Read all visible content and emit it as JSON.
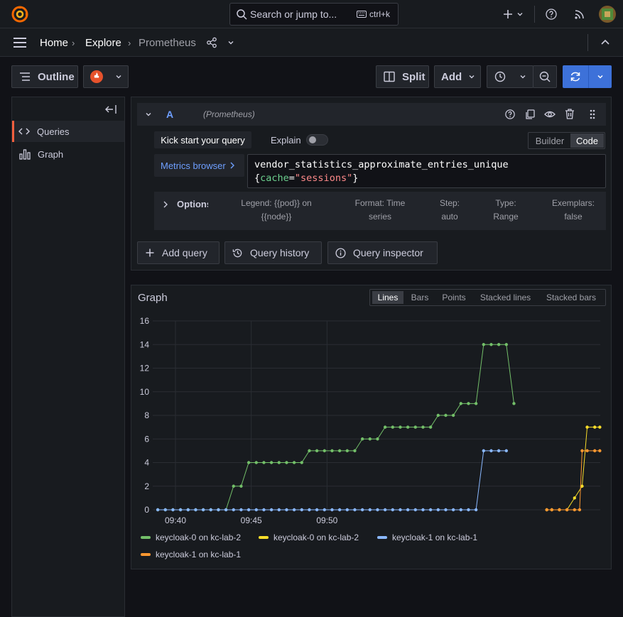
{
  "topbar": {
    "search_placeholder": "Search or jump to...",
    "search_shortcut": "ctrl+k",
    "plus_label": "+"
  },
  "breadcrumb": {
    "items": [
      "Home",
      "Explore",
      "Prometheus"
    ]
  },
  "toolbar": {
    "outline_label": "Outline",
    "split_label": "Split",
    "add_label": "Add"
  },
  "sidebar": {
    "items": [
      {
        "label": "Queries",
        "icon": "code-icon"
      },
      {
        "label": "Graph",
        "icon": "bar-chart-icon"
      }
    ]
  },
  "query": {
    "ref": "A",
    "datasource": "(Prometheus)",
    "kick_start": "Kick start your query",
    "explain": "Explain",
    "mode_builder": "Builder",
    "mode_code": "Code",
    "metrics_browser": "Metrics browser",
    "expr_metric": "vendor_statistics_approximate_entries_unique",
    "expr_brace_open": "{",
    "expr_label": "cache",
    "expr_eq": "=",
    "expr_value": "\"sessions\"",
    "expr_brace_close": "}",
    "options_label": "Options",
    "options": [
      {
        "l1": "Legend: {{pod}} on",
        "l2": "{{node}}"
      },
      {
        "l1": "Format: Time",
        "l2": "series"
      },
      {
        "l1": "Step:",
        "l2": "auto"
      },
      {
        "l1": "Type:",
        "l2": "Range"
      },
      {
        "l1": "Exemplars:",
        "l2": "false"
      }
    ],
    "add_query": "Add query",
    "query_history": "Query history",
    "query_inspector": "Query inspector"
  },
  "graph": {
    "title": "Graph",
    "modes": [
      "Lines",
      "Bars",
      "Points",
      "Stacked lines",
      "Stacked bars"
    ],
    "active_mode": "Lines"
  },
  "colors": {
    "accent_blue": "#3d71d9",
    "grafana_orange": "#f55f3e",
    "green": "#73bf69",
    "yellow": "#fade2a",
    "blue": "#8ab8ff",
    "orange": "#ff9830"
  },
  "chart_data": {
    "type": "line",
    "x_ticks": [
      "09:40",
      "09:45",
      "09:50"
    ],
    "y_ticks": [
      "0",
      "2",
      "4",
      "6",
      "8",
      "10",
      "12",
      "14",
      "16"
    ],
    "ylim": [
      0,
      16
    ],
    "grid": true,
    "legend_position": "bottom",
    "series": [
      {
        "name": "keycloak-0 on kc-lab-2",
        "color": "#73bf69",
        "points": [
          [
            "09:38:50",
            0
          ],
          [
            "09:39:20",
            0
          ],
          [
            "09:39:50",
            0
          ],
          [
            "09:40:20",
            0
          ],
          [
            "09:40:50",
            0
          ],
          [
            "09:41:20",
            0
          ],
          [
            "09:41:50",
            0
          ],
          [
            "09:42:20",
            0
          ],
          [
            "09:42:50",
            0
          ],
          [
            "09:43:20",
            0
          ],
          [
            "09:43:50",
            2
          ],
          [
            "09:44:20",
            2
          ],
          [
            "09:44:50",
            4
          ],
          [
            "09:45:20",
            4
          ],
          [
            "09:45:50",
            4
          ],
          [
            "09:46:20",
            4
          ],
          [
            "09:46:50",
            4
          ],
          [
            "09:47:20",
            4
          ],
          [
            "09:47:50",
            4
          ],
          [
            "09:48:20",
            4
          ],
          [
            "09:48:50",
            5
          ],
          [
            "09:49:20",
            5
          ],
          [
            "09:49:50",
            5
          ],
          [
            "09:50:20",
            5
          ],
          [
            "09:50:50",
            5
          ],
          [
            "09:51:20",
            5
          ],
          [
            "09:51:50",
            5
          ],
          [
            "09:52:20",
            6
          ],
          [
            "09:52:50",
            6
          ],
          [
            "09:53:20",
            6
          ],
          [
            "09:53:50",
            7
          ],
          [
            "09:54:20",
            7
          ],
          [
            "09:54:50",
            7
          ],
          [
            "09:55:20",
            7
          ],
          [
            "09:55:50",
            7
          ],
          [
            "09:56:20",
            7
          ],
          [
            "09:56:50",
            7
          ],
          [
            "09:57:20",
            8
          ],
          [
            "09:57:50",
            8
          ],
          [
            "09:58:20",
            8
          ],
          [
            "09:58:50",
            9
          ],
          [
            "09:59:20",
            9
          ],
          [
            "09:59:50",
            9
          ],
          [
            "10:00:20",
            14
          ],
          [
            "10:00:50",
            14
          ],
          [
            "10:01:20",
            14
          ],
          [
            "10:01:50",
            14
          ],
          [
            "10:02:20",
            9
          ]
        ]
      },
      {
        "name": "keycloak-0 on kc-lab-2",
        "color": "#fade2a",
        "points": [
          [
            "10:04:30",
            0
          ],
          [
            "10:04:50",
            0
          ],
          [
            "10:05:20",
            0
          ],
          [
            "10:05:50",
            0
          ],
          [
            "10:06:20",
            1
          ],
          [
            "10:06:50",
            2
          ],
          [
            "10:07:10",
            7
          ],
          [
            "10:07:40",
            7
          ],
          [
            "10:08:00",
            7
          ]
        ]
      },
      {
        "name": "keycloak-1 on kc-lab-1",
        "color": "#8ab8ff",
        "points": [
          [
            "09:38:50",
            0
          ],
          [
            "09:39:20",
            0
          ],
          [
            "09:39:50",
            0
          ],
          [
            "09:40:20",
            0
          ],
          [
            "09:40:50",
            0
          ],
          [
            "09:41:20",
            0
          ],
          [
            "09:41:50",
            0
          ],
          [
            "09:42:20",
            0
          ],
          [
            "09:42:50",
            0
          ],
          [
            "09:43:20",
            0
          ],
          [
            "09:43:50",
            0
          ],
          [
            "09:44:20",
            0
          ],
          [
            "09:44:50",
            0
          ],
          [
            "09:45:20",
            0
          ],
          [
            "09:45:50",
            0
          ],
          [
            "09:46:20",
            0
          ],
          [
            "09:46:50",
            0
          ],
          [
            "09:47:20",
            0
          ],
          [
            "09:47:50",
            0
          ],
          [
            "09:48:20",
            0
          ],
          [
            "09:48:50",
            0
          ],
          [
            "09:49:20",
            0
          ],
          [
            "09:49:50",
            0
          ],
          [
            "09:50:20",
            0
          ],
          [
            "09:50:50",
            0
          ],
          [
            "09:51:20",
            0
          ],
          [
            "09:51:50",
            0
          ],
          [
            "09:52:20",
            0
          ],
          [
            "09:52:50",
            0
          ],
          [
            "09:53:20",
            0
          ],
          [
            "09:53:50",
            0
          ],
          [
            "09:54:20",
            0
          ],
          [
            "09:54:50",
            0
          ],
          [
            "09:55:20",
            0
          ],
          [
            "09:55:50",
            0
          ],
          [
            "09:56:20",
            0
          ],
          [
            "09:56:50",
            0
          ],
          [
            "09:57:20",
            0
          ],
          [
            "09:57:50",
            0
          ],
          [
            "09:58:20",
            0
          ],
          [
            "09:58:50",
            0
          ],
          [
            "09:59:20",
            0
          ],
          [
            "09:59:50",
            0
          ],
          [
            "10:00:20",
            5
          ],
          [
            "10:00:50",
            5
          ],
          [
            "10:01:20",
            5
          ],
          [
            "10:01:50",
            5
          ]
        ]
      },
      {
        "name": "keycloak-1 on kc-lab-1",
        "color": "#ff9830",
        "points": [
          [
            "10:04:30",
            0
          ],
          [
            "10:04:50",
            0
          ],
          [
            "10:05:20",
            0
          ],
          [
            "10:05:50",
            0
          ],
          [
            "10:06:20",
            0
          ],
          [
            "10:06:40",
            0
          ],
          [
            "10:06:50",
            5
          ],
          [
            "10:07:10",
            5
          ],
          [
            "10:07:40",
            5
          ],
          [
            "10:08:00",
            5
          ]
        ]
      }
    ]
  }
}
